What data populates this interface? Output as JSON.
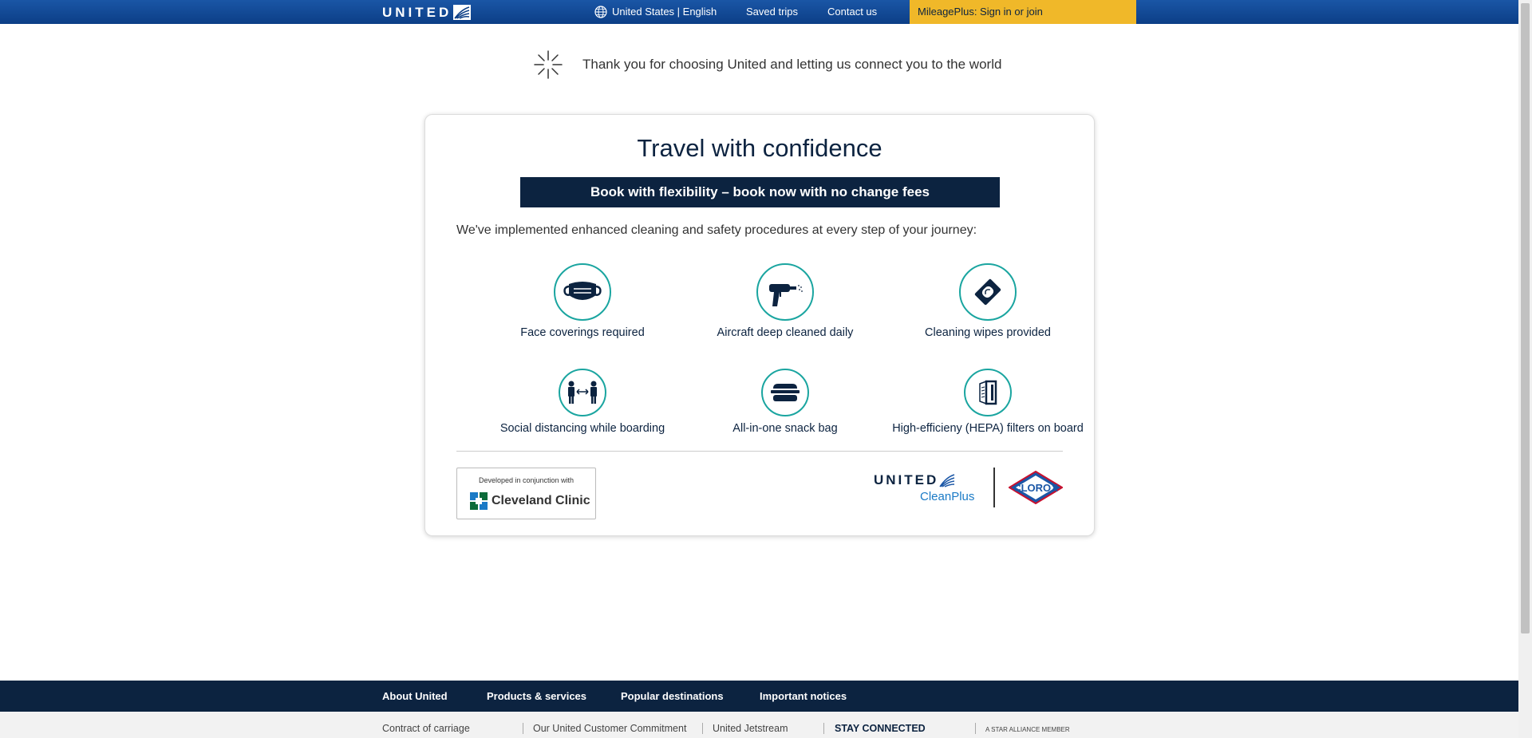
{
  "header": {
    "logo_text": "UNITED",
    "locale": "United States | English",
    "saved_trips": "Saved trips",
    "contact_us": "Contact us",
    "mileageplus": "MileagePlus: Sign in or join"
  },
  "thanks_message": "Thank you for choosing United and letting us connect you to the world",
  "card": {
    "title": "Travel with confidence",
    "banner": "Book with flexibility – book now with no change fees",
    "intro": "We've implemented enhanced cleaning and safety procedures at every step of your journey:",
    "features": [
      {
        "label": "Face coverings required",
        "icon": "face-mask-icon"
      },
      {
        "label": "Aircraft deep cleaned daily",
        "icon": "sprayer-icon"
      },
      {
        "label": "Cleaning wipes provided",
        "icon": "wipes-icon"
      },
      {
        "label": "Social distancing while boarding",
        "icon": "social-distancing-icon"
      },
      {
        "label": "All-in-one snack bag",
        "icon": "snack-bag-icon"
      },
      {
        "label": "High-efficieny (HEPA) filters on board",
        "icon": "hepa-filter-icon"
      }
    ],
    "cleveland_dev": "Developed in conjunction with",
    "cleveland_name": "Cleveland Clinic",
    "united_logo": "UNITED",
    "cleanplus": "CleanPlus",
    "clorox": "CLOROX"
  },
  "footer": {
    "nav": [
      "About United",
      "Products & services",
      "Popular destinations",
      "Important notices"
    ],
    "links": [
      "Contract of carriage",
      "Our United Customer Commitment",
      "United Jetstream",
      "STAY CONNECTED",
      "A STAR ALLIANCE MEMBER"
    ]
  },
  "colors": {
    "header_blue": "#0c3e86",
    "mileage_gold": "#f0b829",
    "navy": "#0c2340",
    "teal": "#1aa5a0"
  }
}
